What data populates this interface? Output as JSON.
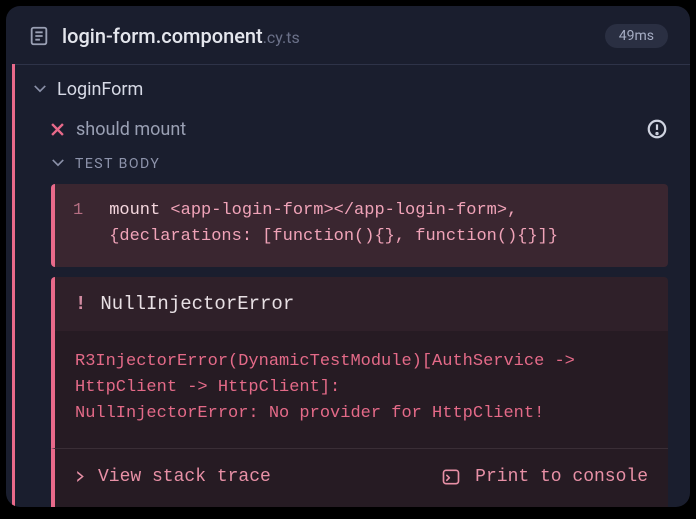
{
  "header": {
    "filename": "login-form.component",
    "extension": ".cy.ts",
    "duration": "49ms"
  },
  "suite": {
    "name": "LoginForm"
  },
  "test": {
    "name": "should mount"
  },
  "testBody": {
    "label": "TEST BODY",
    "lineNumber": "1",
    "mountKeyword": "mount",
    "code": "<app-login-form></app-login-form>, {declarations: [function(){}, function(){}]}"
  },
  "error": {
    "bang": "!",
    "title": "NullInjectorError",
    "body": "R3InjectorError(DynamicTestModule)[AuthService -> HttpClient -> HttpClient]:\nNullInjectorError: No provider for HttpClient!"
  },
  "actions": {
    "viewStack": "View stack trace",
    "printConsole": "Print to console"
  }
}
